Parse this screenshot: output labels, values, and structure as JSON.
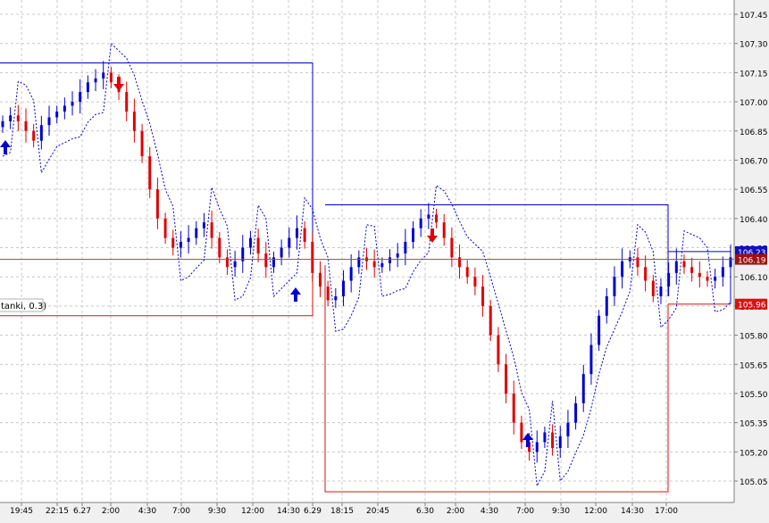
{
  "chart": {
    "price_ticks": [
      "107.45",
      "107.30",
      "107.15",
      "107.00",
      "106.85",
      "106.70",
      "106.55",
      "106.40",
      "106.25",
      "106.10",
      "105.95",
      "105.80",
      "105.65",
      "105.50",
      "105.35",
      "105.20",
      "105.05"
    ],
    "time_ticks": [
      "19:45",
      "22:15",
      "6.27",
      "2:00",
      "4:30",
      "7:00",
      "9:30",
      "12:00",
      "14:30",
      "6.29",
      "18:15",
      "20:45",
      "6.30",
      "2:00",
      "4:30",
      "7:00",
      "9:30",
      "12:00",
      "14:30",
      "17:00"
    ],
    "indicator_label": "tanki, 0.3)",
    "price_markers": [
      {
        "value": "106.23",
        "color": "#1010c0"
      },
      {
        "value": "106.19",
        "color": "#a01010"
      },
      {
        "value": "105.96",
        "color": "#dd1010"
      }
    ],
    "colors": {
      "bull_candle": "#0000d0",
      "bear_candle": "#e00000",
      "box_blue": "#0000cc",
      "box_red": "#dd1010",
      "current_price_line": "#a05010",
      "grid": "#c8c8c8"
    },
    "icons": [
      "buy-arrow-icon",
      "sell-arrow-icon"
    ]
  },
  "chart_data": {
    "type": "candlestick",
    "y_axis": {
      "min": 104.98,
      "max": 107.5,
      "labels_position": "right"
    },
    "x_axis": {
      "labels": [
        "19:45",
        "22:15",
        "6.27",
        "2:00",
        "4:30",
        "7:00",
        "9:30",
        "12:00",
        "14:30",
        "6.29",
        "18:15",
        "20:45",
        "6.30",
        "2:00",
        "4:30",
        "7:00",
        "9:30",
        "12:00",
        "14:30",
        "17:00"
      ]
    },
    "current_price": 106.19,
    "blue_boxes": [
      {
        "from": "start",
        "to": "6.29",
        "high": 107.2,
        "low": 106.16
      },
      {
        "from": "6.29",
        "to": "17:00",
        "high": 106.47,
        "low": 106.0
      },
      {
        "from": "17:00",
        "to": "end",
        "high": 106.23,
        "low": 105.96
      }
    ],
    "red_boxes": [
      {
        "from": "start",
        "to": "6.29",
        "high": 105.9,
        "low": 105.9
      },
      {
        "from": "6.29",
        "to": "17:00",
        "high": 106.16,
        "low": 105.0
      },
      {
        "from": "17:00",
        "to": "end",
        "high": 105.96,
        "low": 105.96
      }
    ],
    "close_path": [
      106.9,
      106.93,
      106.9,
      106.85,
      106.8,
      106.88,
      106.92,
      106.95,
      106.98,
      107.0,
      107.05,
      107.1,
      107.12,
      107.15,
      107.1,
      107.05,
      106.95,
      106.85,
      106.72,
      106.55,
      106.4,
      106.3,
      106.25,
      106.28,
      106.3,
      106.35,
      106.38,
      106.3,
      106.2,
      106.15,
      106.18,
      106.25,
      106.3,
      106.22,
      106.15,
      106.2,
      106.25,
      106.3,
      106.35,
      106.28,
      106.12,
      106.05,
      105.98,
      106.0,
      106.08,
      106.15,
      106.2,
      106.18,
      106.15,
      106.17,
      106.2,
      106.22,
      106.28,
      106.35,
      106.4,
      106.42,
      106.38,
      106.3,
      106.2,
      106.15,
      106.1,
      106.05,
      105.95,
      105.8,
      105.65,
      105.5,
      105.35,
      105.25,
      105.2,
      105.25,
      105.3,
      105.22,
      105.28,
      105.35,
      105.45,
      105.6,
      105.75,
      105.9,
      106.0,
      106.1,
      106.18,
      106.2,
      106.15,
      106.08,
      106.0,
      106.05,
      106.12,
      106.18,
      106.15,
      106.12,
      106.1,
      106.08,
      106.1,
      106.15,
      106.2
    ],
    "buy_signals": [
      "22:15",
      "14:30",
      "7:00"
    ],
    "sell_signals": [
      "2:00",
      "6.30"
    ]
  }
}
